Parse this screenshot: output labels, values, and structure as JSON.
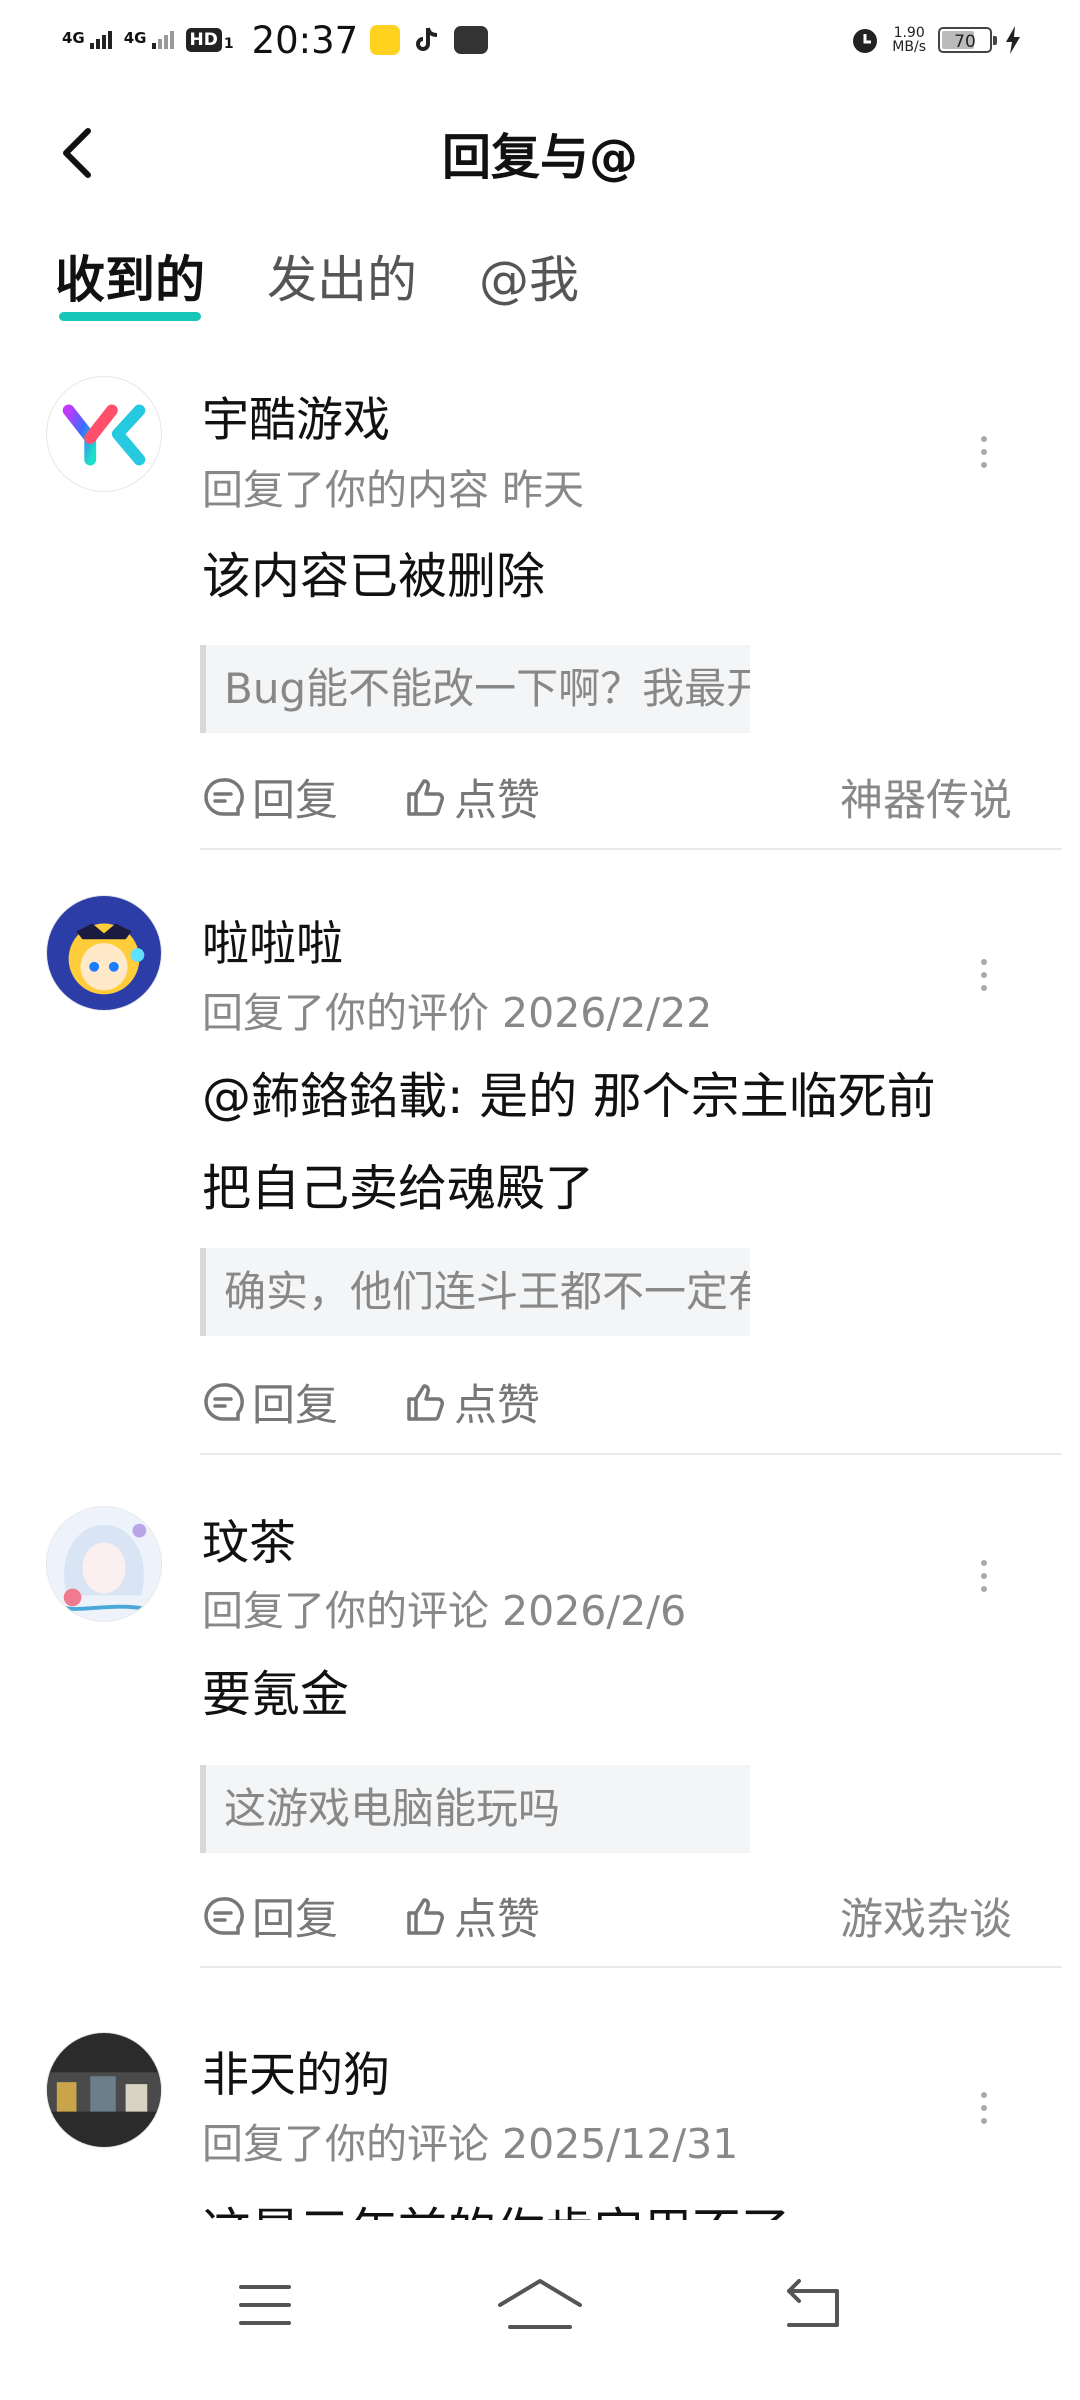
{
  "status_bar": {
    "net1": "4G",
    "net2": "4G",
    "hd": "HD",
    "hd_sub": "1",
    "time": "20:37",
    "speed_value": "1.90",
    "speed_unit": "MB/s",
    "battery": "70",
    "battery_level": 0.7
  },
  "header": {
    "title": "回复与@"
  },
  "tabs": [
    {
      "label": "收到的",
      "active": true
    },
    {
      "label": "发出的",
      "active": false
    },
    {
      "label": "@我",
      "active": false
    }
  ],
  "items": [
    {
      "name": "宇酷游戏",
      "meta": "回复了你的内容 昨天",
      "content": "该内容已被删除",
      "quote": "Bug能不能改一下啊？我最开始玩…",
      "reply_label": "回复",
      "like_label": "点赞",
      "tag": "神器传说"
    },
    {
      "name": "啦啦啦",
      "meta": "回复了你的评价 2026/2/22",
      "content_line1": "@鈽鉻銘載: 是的 那个宗主临死前",
      "content_line2": "把自己卖给魂殿了",
      "quote": "确实，他们连斗王都不一定有，斗…",
      "reply_label": "回复",
      "like_label": "点赞"
    },
    {
      "name": "玟茶",
      "meta": "回复了你的评论 2026/2/6",
      "content": "要氪金",
      "quote": "这游戏电脑能玩吗",
      "reply_label": "回复",
      "like_label": "点赞",
      "tag": "游戏杂谈"
    },
    {
      "name": "非天的狗",
      "meta": "回复了你的评论 2025/12/31",
      "content": "这是三年前的你肯定用不了"
    }
  ],
  "colors": {
    "accent": "#16c6b6",
    "text_primary": "#111111",
    "text_secondary": "#888888"
  }
}
